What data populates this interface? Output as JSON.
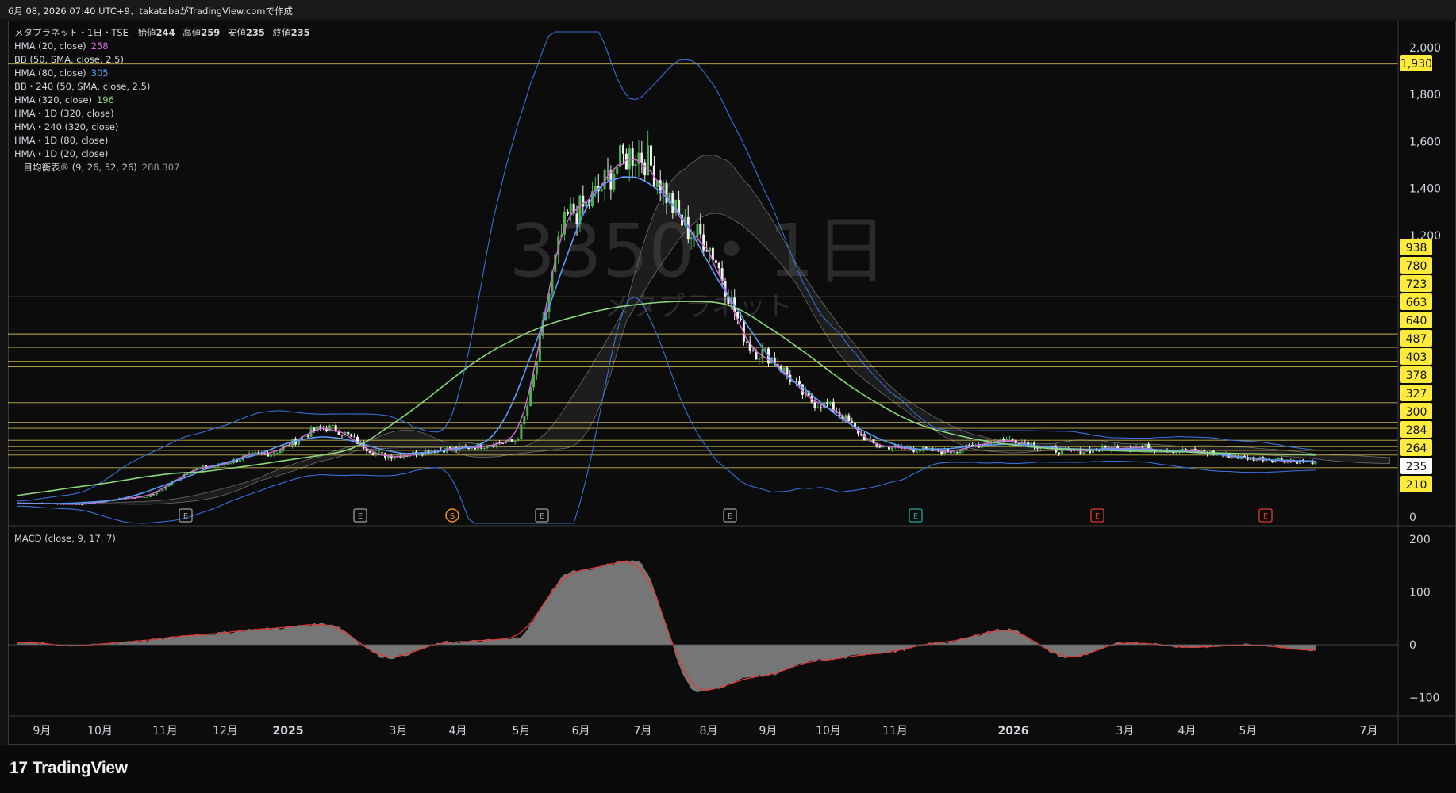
{
  "header": {
    "caption": "6月 08, 2026 07:40 UTC+9、takatabaがTradingView.comで作成"
  },
  "legend": {
    "symbol_line": {
      "name": "メタプラネット・1日・TSE",
      "open_label": "始値",
      "open": "244",
      "high_label": "高値",
      "high": "259",
      "low_label": "安値",
      "low": "235",
      "close_label": "終値",
      "close": "235"
    },
    "indicators": [
      {
        "label": "HMA (20, close)",
        "value": "258",
        "color": "#d26ad6"
      },
      {
        "label": "BB (50, SMA, close, 2.5)",
        "value": "",
        "color": "#2962ff"
      },
      {
        "label": "HMA (80, close)",
        "value": "305",
        "color": "#5b9cf6"
      },
      {
        "label": "BB・240 (50, SMA, close, 2.5)",
        "value": "",
        "color": "#2962ff"
      },
      {
        "label": "HMA (320, close)",
        "value": "196",
        "color": "#8bd67e"
      },
      {
        "label": "HMA・1D (320, close)",
        "value": "",
        "color": "#8bd67e"
      },
      {
        "label": "HMA・240 (320, close)",
        "value": "",
        "color": "#8bd67e"
      },
      {
        "label": "HMA・1D (80, close)",
        "value": "",
        "color": "#5b9cf6"
      },
      {
        "label": "HMA・1D (20, close)",
        "value": "",
        "color": "#d26ad6"
      },
      {
        "label": "一目均衡表® (9, 26, 52, 26)",
        "value": "288  307",
        "color": "#9598a1"
      }
    ]
  },
  "watermark": {
    "main": "3350・1日",
    "sub": "メタプラネット"
  },
  "price_axis": {
    "ticks": [
      "2,000",
      "1,800",
      "1,600",
      "1,400",
      "1,200",
      "0"
    ],
    "levels": [
      "1,930",
      "938",
      "780",
      "723",
      "663",
      "640",
      "487",
      "403",
      "378",
      "327",
      "300",
      "284",
      "264",
      "235",
      "210"
    ],
    "current": "235"
  },
  "time_axis": {
    "labels": [
      "9月",
      "10月",
      "11月",
      "12月",
      "2025",
      "3月",
      "4月",
      "5月",
      "6月",
      "7月",
      "8月",
      "9月",
      "10月",
      "11月",
      "2026",
      "3月",
      "4月",
      "5月",
      "7月"
    ]
  },
  "events": [
    "E",
    "E",
    "S",
    "E",
    "E",
    "E",
    "E",
    "E"
  ],
  "macd": {
    "label": "MACD (close, 9, 17, 7)",
    "ticks": [
      "200",
      "100",
      "0",
      "−100"
    ]
  },
  "brand": {
    "name": "TradingView"
  },
  "colors": {
    "background": "#0c0c0c",
    "level_line": "#e8d15b",
    "up": "#4caf50",
    "down": "#f0f0f0",
    "hma20": "#d26ad6",
    "hma80": "#5b9cf6",
    "hma320": "#8bd67e",
    "bb": "#3a6fd8",
    "macd_hist": "#8a8a8a",
    "signal": "#e53935",
    "badge_level": "#ffeb3b",
    "badge_current": "#ffffff"
  },
  "chart_data": [
    {
      "type": "line",
      "title": "",
      "xlabel": "",
      "ylabel": "",
      "ylim": [
        0,
        2100
      ],
      "x": [
        "2024-09",
        "2024-10",
        "2024-11",
        "2024-12",
        "2025-01",
        "2025-02",
        "2025-03",
        "2025-04",
        "2025-05",
        "2025-06",
        "2025-07",
        "2025-08",
        "2025-09",
        "2025-10",
        "2025-11",
        "2025-12",
        "2026-01",
        "2026-02",
        "2026-03",
        "2026-04",
        "2026-05",
        "2026-06"
      ],
      "series": [
        {
          "values": [
            60,
            55,
            85,
            210,
            270,
            380,
            260,
            290,
            320,
            1300,
            1550,
            1200,
            700,
            480,
            300,
            280,
            330,
            280,
            300,
            280,
            250,
            235
          ]
        }
      ],
      "price_levels": [
        1930,
        938,
        780,
        723,
        663,
        640,
        487,
        403,
        378,
        327,
        300,
        284,
        264,
        235,
        210
      ],
      "legend": [
        "HMA (20, close)",
        "BB (50, SMA, close, 2.5)",
        "HMA (80, close)",
        "HMA (320, close)",
        "一目均衡表® (9, 26, 52, 26)"
      ],
      "grid": false
    },
    {
      "type": "area",
      "title": "MACD (close, 9, 17, 7)",
      "ylim": [
        -130,
        220
      ],
      "x": [
        "2024-09",
        "2024-10",
        "2024-11",
        "2024-12",
        "2025-01",
        "2025-02",
        "2025-03",
        "2025-04",
        "2025-05",
        "2025-06",
        "2025-07",
        "2025-08",
        "2025-09",
        "2025-10",
        "2025-11",
        "2025-12",
        "2026-01",
        "2026-02",
        "2026-03",
        "2026-04",
        "2026-05",
        "2026-06"
      ],
      "series": [
        {
          "values": [
            5,
            -2,
            8,
            20,
            30,
            40,
            -25,
            5,
            10,
            140,
            160,
            -90,
            -60,
            -30,
            -15,
            5,
            30,
            -25,
            5,
            -5,
            0,
            -10
          ]
        }
      ]
    }
  ]
}
